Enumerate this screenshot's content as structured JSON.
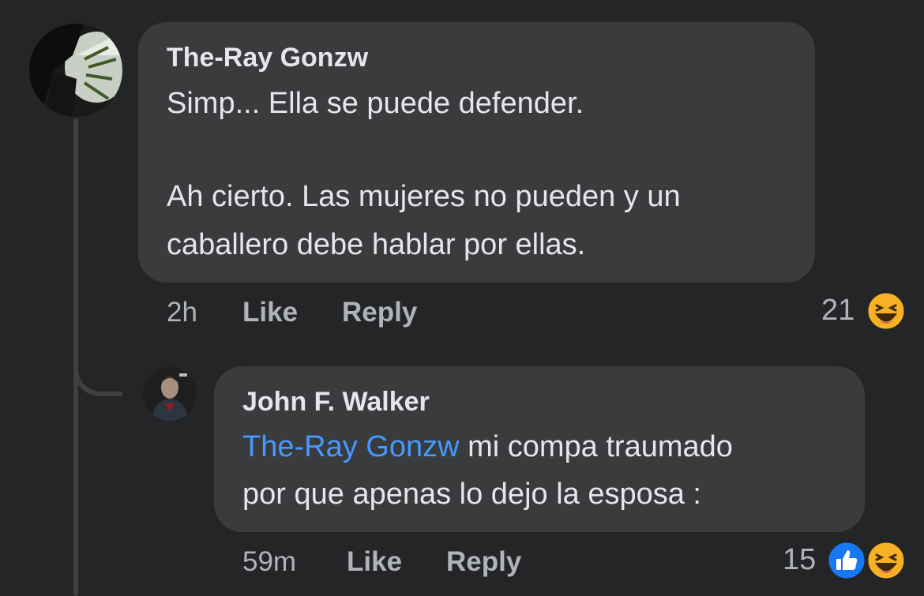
{
  "comments": [
    {
      "author": "The-Ray Gonzw",
      "lines": [
        "Simp... Ella se puede defender.",
        "",
        "Ah cierto. Las mujeres no pueden y un",
        "caballero debe hablar por ellas."
      ],
      "time": "2h",
      "like_label": "Like",
      "reply_label": "Reply",
      "reaction_count": "21",
      "reactions": [
        "haha-icon"
      ]
    },
    {
      "author": "John F. Walker",
      "mention": "The-Ray Gonzw",
      "line1_rest": " mi compa traumado",
      "line2": "por que apenas lo dejo la esposa :",
      "time": "59m",
      "like_label": "Like",
      "reply_label": "Reply",
      "reaction_count": "15",
      "reactions": [
        "like-icon",
        "haha-icon"
      ]
    }
  ],
  "colors": {
    "background": "#242526",
    "bubble": "#3a3b3c",
    "text": "#e4e6eb",
    "meta": "#b0b3b8",
    "mention": "#4599ff",
    "like_reaction": "#1877f2",
    "haha_reaction": "#f7b125"
  }
}
